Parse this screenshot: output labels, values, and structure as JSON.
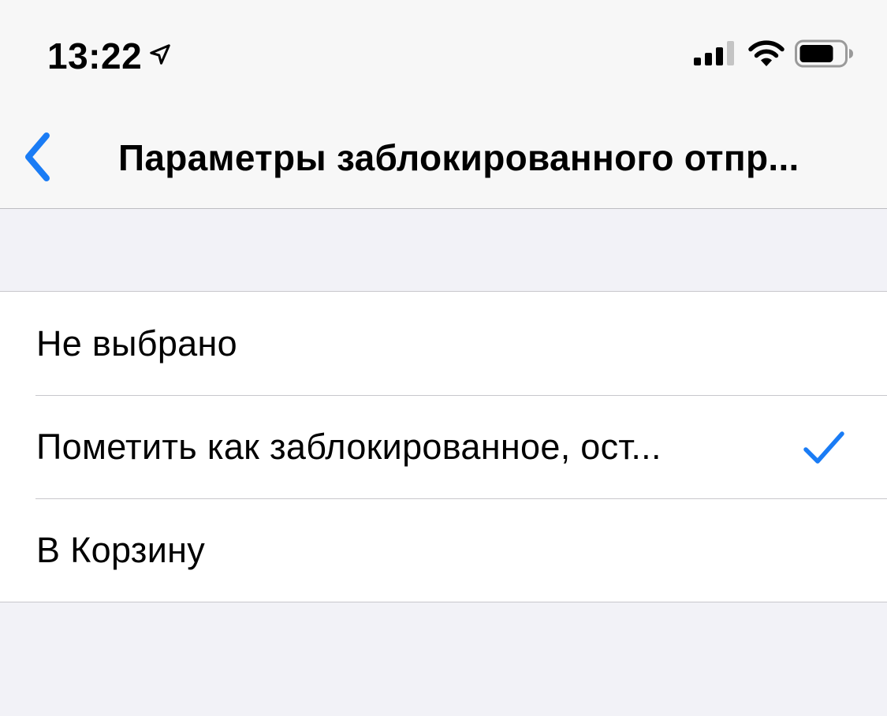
{
  "status_bar": {
    "time": "13:22",
    "icons": [
      "location-arrow-icon",
      "cellular-signal-icon",
      "wifi-icon",
      "battery-icon"
    ]
  },
  "nav": {
    "back_icon": "chevron-left-icon",
    "title": "Параметры заблокированного отпр..."
  },
  "options": [
    {
      "label": "Не выбрано",
      "selected": false
    },
    {
      "label": "Пометить как заблокированное, ост...",
      "selected": true
    },
    {
      "label": "В Корзину",
      "selected": false
    }
  ],
  "colors": {
    "accent": "#1A7CF5",
    "background": "#F2F2F7",
    "bar_background": "#F7F7F7",
    "separator": "#C8C7CC"
  }
}
